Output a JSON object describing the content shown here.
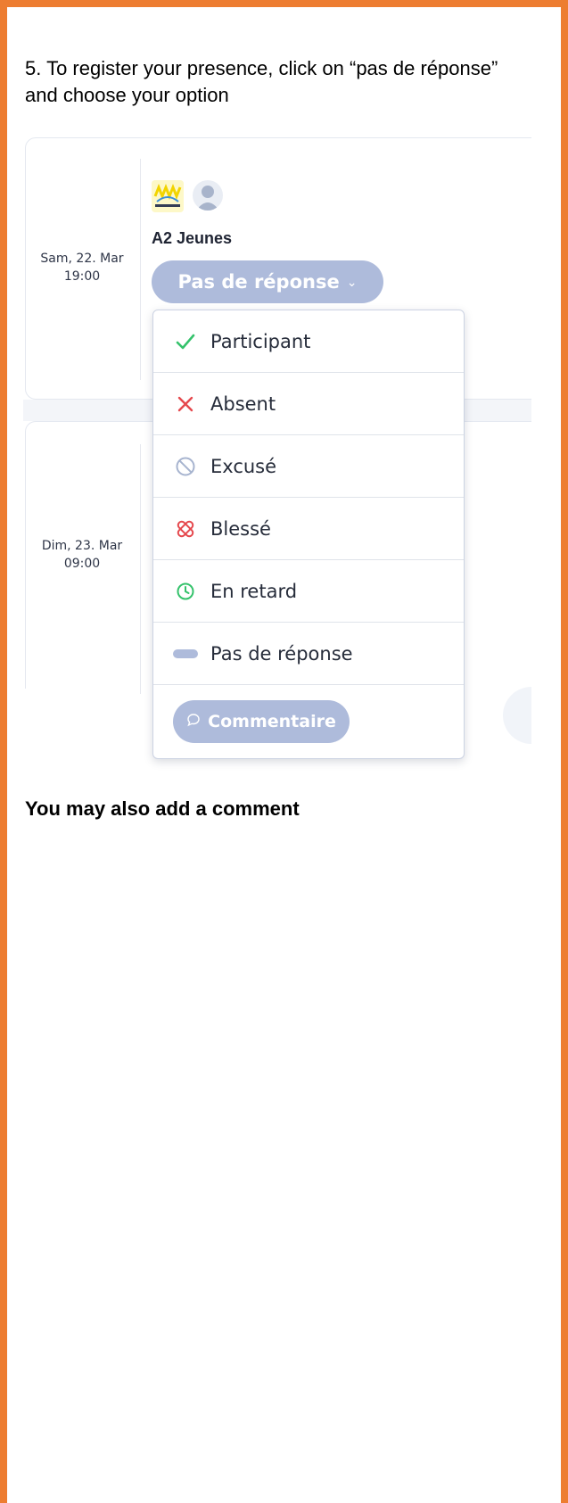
{
  "instruction": {
    "text": "5. To register your presence, click on “pas de réponse” and choose your option"
  },
  "events": [
    {
      "date": "Sam, 22. Mar",
      "time": "19:00",
      "team": "A2 Jeunes",
      "response": "Pas de réponse"
    },
    {
      "date": "Dim, 23. Mar",
      "time": "09:00"
    }
  ],
  "dropdown": {
    "options": [
      {
        "label": "Participant",
        "icon": "checkmark-icon",
        "color": "#34c26b"
      },
      {
        "label": "Absent",
        "icon": "cross-icon",
        "color": "#e5484d"
      },
      {
        "label": "Excusé",
        "icon": "prohibited-icon",
        "color": "#a7b4cf"
      },
      {
        "label": "Blessé",
        "icon": "bandage-icon",
        "color": "#e5484d"
      },
      {
        "label": "En retard",
        "icon": "clock-icon",
        "color": "#34c26b"
      },
      {
        "label": "Pas de réponse",
        "icon": "dash-icon",
        "color": "#aebbdb"
      }
    ],
    "comment_label": "Commentaire"
  },
  "footer": {
    "text": "You may also add a comment"
  },
  "colors": {
    "frame": "#ED7D31",
    "pill": "#aebbdb"
  }
}
